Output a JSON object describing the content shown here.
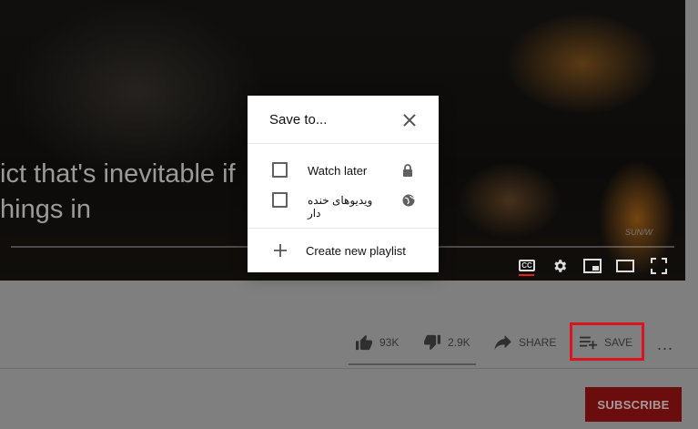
{
  "video": {
    "caption_line1": "ict that's inevitable if",
    "caption_line2": "hings in",
    "watermark": "SUN/W"
  },
  "actions": {
    "like_count": "93K",
    "dislike_count": "2.9K",
    "share_label": "SHARE",
    "save_label": "SAVE",
    "more_label": "..."
  },
  "subscribe_label": "SUBSCRIBE",
  "dialog": {
    "title": "Save to...",
    "playlists": [
      {
        "label": "Watch later",
        "icon": "lock-icon",
        "checked": false
      },
      {
        "label": "ویدیوهای خنده دار",
        "icon": "globe-icon",
        "checked": false
      }
    ],
    "create_label": "Create new playlist"
  },
  "colors": {
    "highlight": "#d9141e",
    "subscribe_bg": "#6b0d0d",
    "cc_accent": "#e62117"
  }
}
